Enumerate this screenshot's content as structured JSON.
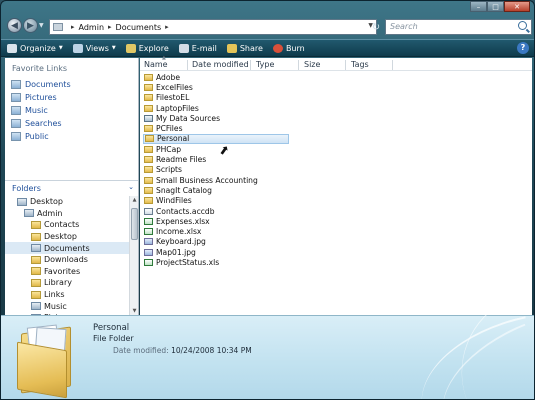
{
  "address": {
    "crumbs": [
      "Admin",
      "Documents"
    ],
    "search_placeholder": "Search"
  },
  "window_controls": {
    "minimize": "–",
    "maximize": "□",
    "close": "✕"
  },
  "toolbar": {
    "items": [
      {
        "label": "Organize",
        "icon": "organize-icon",
        "color": "#d9e4ec",
        "dropdown": true
      },
      {
        "label": "Views",
        "icon": "views-icon",
        "color": "#bcd3e6",
        "dropdown": true
      },
      {
        "label": "Explore",
        "icon": "explore-icon",
        "color": "#e0c765",
        "dropdown": false
      },
      {
        "label": "E-mail",
        "icon": "email-icon",
        "color": "#d4dde6",
        "dropdown": false
      },
      {
        "label": "Share",
        "icon": "share-icon",
        "color": "#e4c458",
        "dropdown": false
      },
      {
        "label": "Burn",
        "icon": "burn-icon",
        "color": "#d9503a",
        "dropdown": false
      }
    ],
    "help": "?"
  },
  "nav": {
    "favorite_header": "Favorite Links",
    "favorites": [
      "Documents",
      "Pictures",
      "Music",
      "Searches",
      "Public"
    ],
    "folders_header": "Folders",
    "tree": [
      {
        "label": "Desktop",
        "indent": 0,
        "sys": true
      },
      {
        "label": "Admin",
        "indent": 1,
        "sys": true
      },
      {
        "label": "Contacts",
        "indent": 2,
        "sys": false
      },
      {
        "label": "Desktop",
        "indent": 2,
        "sys": false
      },
      {
        "label": "Documents",
        "indent": 2,
        "sys": true,
        "selected": true
      },
      {
        "label": "Downloads",
        "indent": 2,
        "sys": false
      },
      {
        "label": "Favorites",
        "indent": 2,
        "sys": false
      },
      {
        "label": "Library",
        "indent": 2,
        "sys": false
      },
      {
        "label": "Links",
        "indent": 2,
        "sys": false
      },
      {
        "label": "Music",
        "indent": 2,
        "sys": true
      },
      {
        "label": "Pictures",
        "indent": 2,
        "sys": true
      }
    ]
  },
  "columns": [
    "Name",
    "Date modified",
    "Type",
    "Size",
    "Tags"
  ],
  "files": [
    {
      "name": "Adobe",
      "kind": "folder"
    },
    {
      "name": "ExcelFiles",
      "kind": "folder"
    },
    {
      "name": "FilestoEL",
      "kind": "folder"
    },
    {
      "name": "LaptopFiles",
      "kind": "folder"
    },
    {
      "name": "My Data Sources",
      "kind": "mds"
    },
    {
      "name": "PCFiles",
      "kind": "folder"
    },
    {
      "name": "Personal",
      "kind": "folder",
      "selected": true
    },
    {
      "name": "PHCap",
      "kind": "folder"
    },
    {
      "name": "Readme Files",
      "kind": "folder"
    },
    {
      "name": "Scripts",
      "kind": "folder"
    },
    {
      "name": "Small Business Accounting",
      "kind": "folder"
    },
    {
      "name": "SnagIt Catalog",
      "kind": "folder"
    },
    {
      "name": "WindFiles",
      "kind": "folder"
    },
    {
      "name": "Contacts.accdb",
      "kind": "doc"
    },
    {
      "name": "Expenses.xlsx",
      "kind": "xls"
    },
    {
      "name": "Income.xlsx",
      "kind": "xls"
    },
    {
      "name": "Keyboard.jpg",
      "kind": "img"
    },
    {
      "name": "Map01.jpg",
      "kind": "img"
    },
    {
      "name": "ProjectStatus.xls",
      "kind": "xls"
    }
  ],
  "details": {
    "name": "Personal",
    "type": "File Folder",
    "date_label": "Date modified:",
    "date_value": "10/24/2008 10:34 PM"
  }
}
